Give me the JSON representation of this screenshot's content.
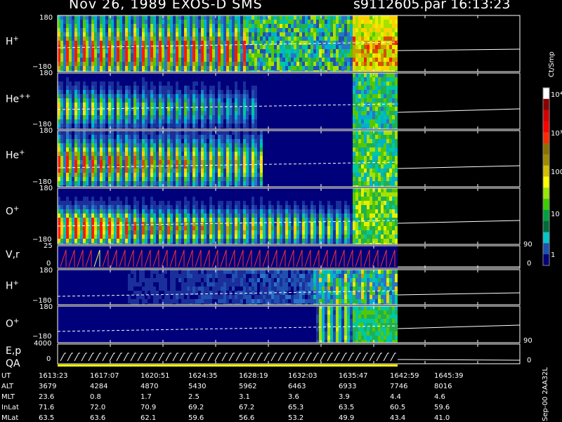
{
  "header": {
    "title": "Nov 26, 1989    EXOS-D SMS",
    "file": "s9112605.par  16:13:23"
  },
  "panels": [
    {
      "label": "H",
      "sup": "+",
      "top": "180",
      "bottom": "−180"
    },
    {
      "label": "He",
      "sup": "++",
      "top": "180",
      "bottom": "−180"
    },
    {
      "label": "He",
      "sup": "+",
      "top": "180",
      "bottom": "−180"
    },
    {
      "label": "O",
      "sup": "+",
      "top": "180",
      "bottom": "−180"
    }
  ],
  "vr": {
    "label": "V,r",
    "top": "25",
    "bottom": "0",
    "right_top": "90",
    "right_bottom": "0"
  },
  "panels2": [
    {
      "label": "H",
      "sup": "+",
      "top": "180",
      "bottom": "−180"
    },
    {
      "label": "O",
      "sup": "+",
      "top": "180",
      "bottom": "−180"
    }
  ],
  "ep": {
    "label1": "E,p",
    "label2": "QA",
    "top": "4000",
    "bottom": "0",
    "right_top": "90",
    "right_bottom": "0"
  },
  "colorbar": {
    "unit": "Ct/Smp",
    "ticks": [
      {
        "text": "10⁴"
      },
      {
        "text": "10³"
      },
      {
        "text": "100"
      },
      {
        "text": "10"
      },
      {
        "text": "1"
      }
    ],
    "colors": [
      "#ffffff",
      "#8b0000",
      "#d40000",
      "#ff0000",
      "#ff2a00",
      "#8b7000",
      "#a08a00",
      "#d4c000",
      "#ffff00",
      "#9ae600",
      "#3bcd00",
      "#00a040",
      "#006b3a",
      "#00c8c8",
      "#2050b0",
      "#00007a"
    ]
  },
  "footer": {
    "rows": [
      {
        "label": "UT",
        "values": [
          "1613:23",
          "1617:07",
          "1620:51",
          "1624:35",
          "1628:19",
          "1632:03",
          "1635:47",
          "1642:59",
          "1645:39"
        ]
      },
      {
        "label": "ALT",
        "values": [
          "3679",
          "4284",
          "4870",
          "5430",
          "5962",
          "6463",
          "6933",
          "7746",
          "8016"
        ]
      },
      {
        "label": "MLT",
        "values": [
          "23.6",
          "0.8",
          "1.7",
          "2.5",
          "3.1",
          "3.6",
          "3.9",
          "4.4",
          "4.6"
        ]
      },
      {
        "label": "InLat",
        "values": [
          "71.6",
          "72.0",
          "70.9",
          "69.2",
          "67.2",
          "65.3",
          "63.5",
          "60.5",
          "59.6"
        ]
      },
      {
        "label": "MLat",
        "values": [
          "63.5",
          "63.6",
          "62.1",
          "59.6",
          "56.6",
          "53.2",
          "49.9",
          "43.4",
          "41.0"
        ]
      }
    ],
    "stamp": "Sep-00  2AA32L"
  },
  "chart_data": {
    "type": "heatmap",
    "title": "Nov 26, 1989    EXOS-D SMS",
    "x_ticks": [
      "1613:23",
      "1617:07",
      "1620:51",
      "1624:35",
      "1628:19",
      "1632:03",
      "1635:47",
      "1642:59",
      "1645:39"
    ],
    "data_end": "1635:47",
    "series": [
      {
        "name": "H+",
        "ylim": [
          -180,
          180
        ]
      },
      {
        "name": "He++",
        "ylim": [
          -180,
          180
        ]
      },
      {
        "name": "He+",
        "ylim": [
          -180,
          180
        ]
      },
      {
        "name": "O+",
        "ylim": [
          -180,
          180
        ]
      },
      {
        "name": "V,r",
        "ylim": [
          0,
          25
        ]
      },
      {
        "name": "H+",
        "ylim": [
          -180,
          180
        ]
      },
      {
        "name": "O+",
        "ylim": [
          -180,
          180
        ]
      },
      {
        "name": "E,p",
        "ylim": [
          0,
          4000
        ]
      }
    ],
    "colorbar": {
      "label": "Ct/Smp",
      "scale": "log",
      "range": [
        1,
        10000
      ]
    }
  }
}
